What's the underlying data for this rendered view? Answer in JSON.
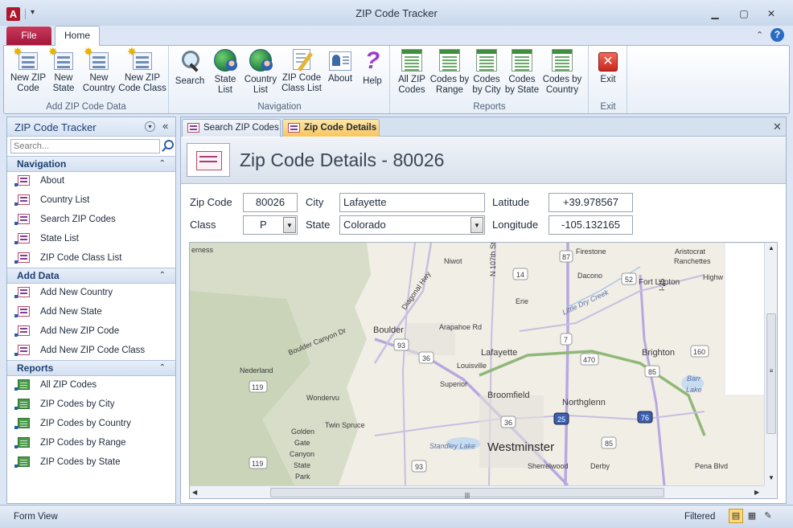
{
  "window": {
    "title": "ZIP Code Tracker",
    "app_icon": "A",
    "qat_arrow": "▾",
    "minimize": "▁",
    "maximize": "▢",
    "close": "✕"
  },
  "ribbon": {
    "tabs": [
      {
        "label": "File"
      },
      {
        "label": "Home"
      }
    ],
    "up_glyph": "⌃",
    "help_glyph": "?",
    "groups": [
      {
        "label": "Add ZIP Code Data",
        "buttons": [
          {
            "label": "New ZIP\nCode",
            "icon": "new-zip-code-icon"
          },
          {
            "label": "New\nState",
            "icon": "new-state-icon"
          },
          {
            "label": "New\nCountry",
            "icon": "new-country-icon"
          },
          {
            "label": "New ZIP\nCode Class",
            "icon": "new-zip-code-class-icon"
          }
        ]
      },
      {
        "label": "Navigation",
        "buttons": [
          {
            "label": "Search",
            "icon": "search-icon"
          },
          {
            "label": "State\nList",
            "icon": "state-list-icon"
          },
          {
            "label": "Country\nList",
            "icon": "country-list-icon"
          },
          {
            "label": "ZIP Code\nClass List",
            "icon": "zip-code-class-list-icon"
          },
          {
            "label": "About",
            "icon": "about-icon"
          },
          {
            "label": "Help",
            "icon": "help-icon"
          }
        ]
      },
      {
        "label": "Reports",
        "buttons": [
          {
            "label": "All ZIP\nCodes",
            "icon": "report-icon"
          },
          {
            "label": "Codes by\nRange",
            "icon": "report-icon"
          },
          {
            "label": "Codes\nby City",
            "icon": "report-icon"
          },
          {
            "label": "Codes\nby State",
            "icon": "report-icon"
          },
          {
            "label": "Codes by\nCountry",
            "icon": "report-icon"
          }
        ]
      },
      {
        "label": "Exit",
        "buttons": [
          {
            "label": "Exit",
            "icon": "exit-icon"
          }
        ]
      }
    ]
  },
  "nav": {
    "title": "ZIP Code Tracker",
    "dropdown_glyph": "▾",
    "collapse_glyph": "«",
    "search_placeholder": "Search...",
    "chevron": "⌃",
    "sections": [
      {
        "title": "Navigation",
        "items": [
          "About",
          "Country List",
          "Search ZIP Codes",
          "State List",
          "ZIP Code Class List"
        ]
      },
      {
        "title": "Add Data",
        "items": [
          "Add New Country",
          "Add New State",
          "Add New ZIP Code",
          "Add New ZIP Code Class"
        ]
      },
      {
        "title": "Reports",
        "items": [
          "All ZIP Codes",
          "ZIP Codes by City",
          "ZIP Codes by Country",
          "ZIP Codes by Range",
          "ZIP Codes by State"
        ]
      }
    ]
  },
  "doc_tabs": [
    {
      "label": "Search ZIP Codes",
      "active": false
    },
    {
      "label": "Zip Code Details",
      "active": true
    }
  ],
  "doc_close": "✕",
  "form": {
    "title": "Zip Code Details - 80026",
    "labels": {
      "zip": "Zip Code",
      "class": "Class",
      "city": "City",
      "state": "State",
      "latitude": "Latitude",
      "longitude": "Longitude"
    },
    "values": {
      "zip": "80026",
      "class": "P",
      "city": "Lafayette",
      "state": "Colorado",
      "latitude": "+39.978567",
      "longitude": "-105.132165"
    },
    "dd_glyph": "▼"
  },
  "map": {
    "labels": {
      "erness": "erness",
      "niwot": "Niwot",
      "n107": "N 107th St",
      "hwy87": "87",
      "firestone": "Firestone",
      "aristocrat": "Aristocrat",
      "ranchettes": "Ranchettes",
      "i25": "I-25",
      "diagonal": "Diagonal Hwy",
      "hwy14": "14",
      "dacono": "Dacono",
      "hwy52": "52",
      "fortlupton": "Fort Lupton",
      "highw": "Highw",
      "littledry": "Little Dry Creek",
      "erie": "Erie",
      "boulder": "Boulder",
      "arapahoe": "Arapahoe Rd",
      "bouldercanyon": "Boulder Canyon Dr",
      "hwy93a": "93",
      "hwy7": "7",
      "lafayette": "Lafayette",
      "brighton": "Brighton",
      "hwy160": "160",
      "nederland": "Nederland",
      "hwy36a": "36",
      "louisville": "Louisville",
      "hwy470": "470",
      "hwy85a": "85",
      "barr": "Barr",
      "lake": "Lake",
      "hwy119": "119",
      "superior": "Superior",
      "broomfield": "Broomfield",
      "wondervu": "Wondervu",
      "northglenn": "Northglenn",
      "twinspruce": "Twin Spruce",
      "hwy36b": "36",
      "hwy25": "25",
      "hwy76": "76",
      "golden": "Golden",
      "gate": "Gate",
      "canyon": "Canyon",
      "state": "State",
      "park": "Park",
      "standley": "Standley Lake",
      "westminster": "Westminster",
      "hwy85b": "85",
      "hwy119b": "119",
      "hwy93b": "93",
      "sherrelwood": "Sherrelwood",
      "derby": "Derby",
      "penablvd": "Pena Blvd"
    },
    "scroll": {
      "up": "▲",
      "down": "▼",
      "left": "◀",
      "right": "▶",
      "grip_v": "≡",
      "grip_h": "|||"
    }
  },
  "status": {
    "left": "Form View",
    "right": "Filtered"
  }
}
